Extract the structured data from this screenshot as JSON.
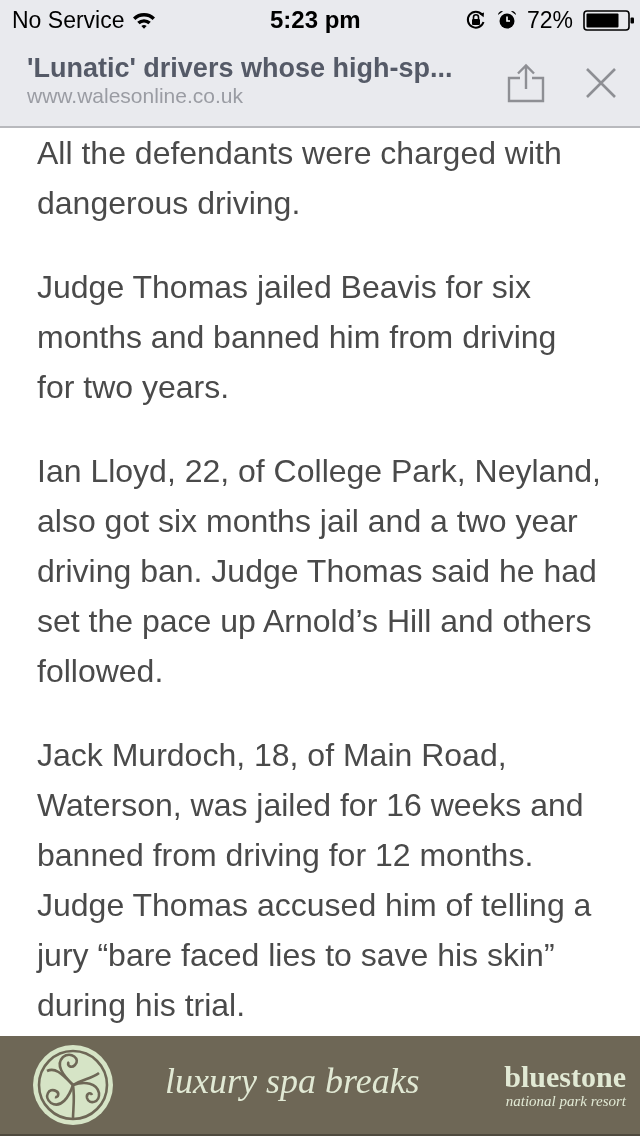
{
  "status_bar": {
    "carrier": "No Service",
    "time": "5:23 pm",
    "battery_percent": "72%"
  },
  "browser_header": {
    "title": "'Lunatic' drivers whose high-sp...",
    "url": "www.walesonline.co.uk"
  },
  "article": {
    "paragraphs": [
      "All the defendants were charged with dangerous driving.",
      "Judge Thomas jailed Beavis for six months and banned him from driving for two years.",
      "Ian Lloyd, 22, of College Park, Neyland, also got six months jail and a two year driving ban. Judge Thomas said he had set the pace up Arnold’s Hill and others followed.",
      "Jack Murdoch, 18, of Main Road, Waterson, was jailed for 16 weeks and banned from driving for 12 months. Judge Thomas accused him of telling a jury “bare faced lies to save his skin” during his trial."
    ]
  },
  "ad_banner": {
    "tagline": "luxury spa breaks",
    "brand": "bluestone",
    "brand_subtitle": "national park resort"
  }
}
